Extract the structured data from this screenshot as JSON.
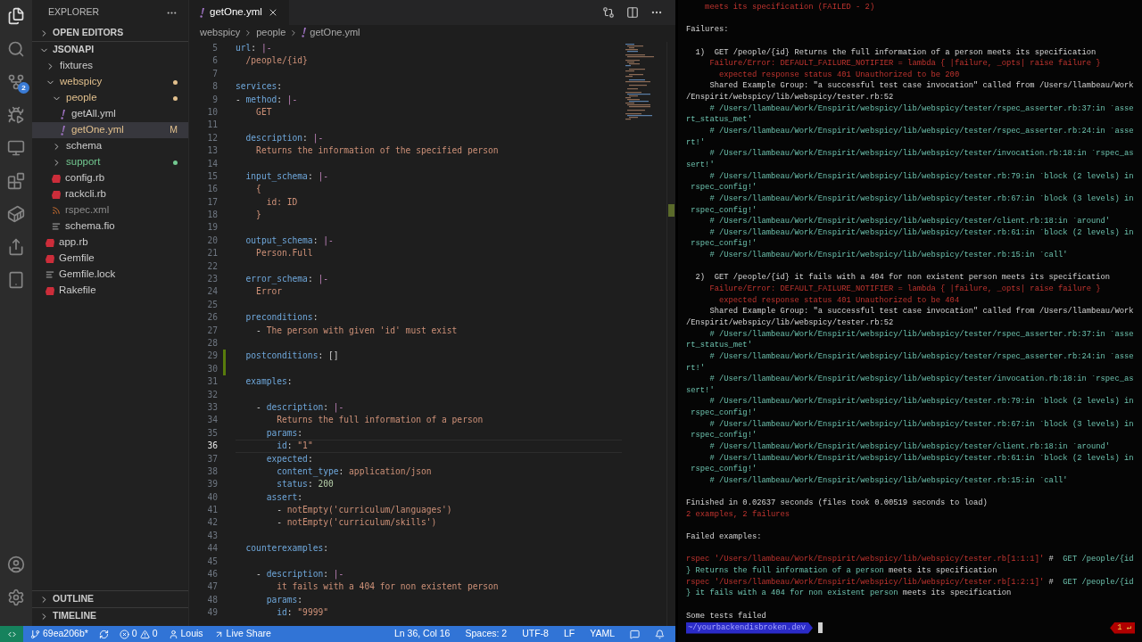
{
  "activity_bar": {
    "scm_badge": "2"
  },
  "explorer": {
    "title": "EXPLORER",
    "open_editors": {
      "label": "OPEN EDITORS",
      "expanded": false
    },
    "tree": {
      "label": "JSONAPI",
      "expanded": true,
      "children": [
        {
          "label": "fixtures",
          "kind": "folder",
          "expanded": false,
          "color": "#cccccc",
          "dot": false,
          "selected": false
        },
        {
          "label": "webspicy",
          "kind": "folder",
          "expanded": true,
          "color": "#e2c08d",
          "dot": true,
          "selected": false,
          "children": [
            {
              "label": "people",
              "kind": "folder",
              "expanded": true,
              "color": "#e2c08d",
              "dot": true,
              "selected": false,
              "children": [
                {
                  "label": "getAll.yml",
                  "kind": "yaml",
                  "color": "#cccccc",
                  "selected": false
                },
                {
                  "label": "getOne.yml",
                  "kind": "yaml",
                  "color": "#e2c08d",
                  "badge": "M",
                  "selected": true
                }
              ]
            },
            {
              "label": "schema",
              "kind": "folder",
              "expanded": false,
              "color": "#cccccc",
              "dot": false,
              "selected": false
            },
            {
              "label": "support",
              "kind": "folder",
              "expanded": false,
              "color": "#73c991",
              "dot": true,
              "selected": false
            },
            {
              "label": "config.rb",
              "kind": "ruby",
              "color": "#cccccc",
              "selected": false
            },
            {
              "label": "rackcli.rb",
              "kind": "ruby",
              "color": "#cccccc",
              "selected": false
            },
            {
              "label": "rspec.xml",
              "kind": "feed",
              "color": "#8c8c8c",
              "selected": false
            },
            {
              "label": "schema.fio",
              "kind": "text",
              "color": "#cccccc",
              "selected": false
            }
          ]
        },
        {
          "label": "app.rb",
          "kind": "ruby",
          "color": "#cccccc",
          "selected": false
        },
        {
          "label": "Gemfile",
          "kind": "ruby",
          "color": "#cccccc",
          "selected": false
        },
        {
          "label": "Gemfile.lock",
          "kind": "text",
          "color": "#cccccc",
          "selected": false
        },
        {
          "label": "Rakefile",
          "kind": "ruby",
          "color": "#cccccc",
          "selected": false
        }
      ]
    },
    "outline": {
      "label": "OUTLINE",
      "expanded": false
    },
    "timeline": {
      "label": "TIMELINE",
      "expanded": false
    }
  },
  "editor": {
    "tab": {
      "label": "getOne.yml",
      "selected": true
    },
    "breadcrumbs": [
      "webspicy",
      "people",
      "getOne.yml"
    ],
    "lines": [
      {
        "n": "5",
        "added": false,
        "current": false,
        "segs": [
          {
            "kind": "key",
            "t": "url"
          },
          {
            "kind": "punct",
            "t": ": "
          },
          {
            "kind": "op",
            "t": "|-"
          }
        ]
      },
      {
        "n": "6",
        "added": false,
        "current": false,
        "segs": [
          {
            "kind": "str",
            "t": "  /people/{id}"
          }
        ]
      },
      {
        "n": "7",
        "added": false,
        "current": false
      },
      {
        "n": "8",
        "added": false,
        "current": false,
        "segs": [
          {
            "kind": "key",
            "t": "services"
          },
          {
            "kind": "punct",
            "t": ":"
          }
        ]
      },
      {
        "n": "9",
        "added": false,
        "current": false,
        "segs": [
          {
            "kind": "punct",
            "t": "- "
          },
          {
            "kind": "key",
            "t": "method"
          },
          {
            "kind": "punct",
            "t": ": "
          },
          {
            "kind": "op",
            "t": "|-"
          }
        ]
      },
      {
        "n": "10",
        "added": false,
        "current": false,
        "segs": [
          {
            "kind": "str",
            "t": "    GET"
          }
        ]
      },
      {
        "n": "11",
        "added": false,
        "current": false
      },
      {
        "n": "12",
        "added": false,
        "current": false,
        "segs": [
          {
            "kind": "key",
            "t": "  description"
          },
          {
            "kind": "punct",
            "t": ": "
          },
          {
            "kind": "op",
            "t": "|-"
          }
        ]
      },
      {
        "n": "13",
        "added": false,
        "current": false,
        "segs": [
          {
            "kind": "str",
            "t": "    Returns the information of the specified person"
          }
        ]
      },
      {
        "n": "14",
        "added": false,
        "current": false
      },
      {
        "n": "15",
        "added": false,
        "current": false,
        "segs": [
          {
            "kind": "key",
            "t": "  input_schema"
          },
          {
            "kind": "punct",
            "t": ": "
          },
          {
            "kind": "op",
            "t": "|-"
          }
        ]
      },
      {
        "n": "16",
        "added": false,
        "current": false,
        "segs": [
          {
            "kind": "str",
            "t": "    {"
          }
        ]
      },
      {
        "n": "17",
        "added": false,
        "current": false,
        "segs": [
          {
            "kind": "str",
            "t": "      id: ID"
          }
        ]
      },
      {
        "n": "18",
        "added": false,
        "current": false,
        "segs": [
          {
            "kind": "str",
            "t": "    }"
          }
        ]
      },
      {
        "n": "19",
        "added": false,
        "current": false
      },
      {
        "n": "20",
        "added": false,
        "current": false,
        "segs": [
          {
            "kind": "key",
            "t": "  output_schema"
          },
          {
            "kind": "punct",
            "t": ": "
          },
          {
            "kind": "op",
            "t": "|-"
          }
        ]
      },
      {
        "n": "21",
        "added": false,
        "current": false,
        "segs": [
          {
            "kind": "str",
            "t": "    Person.Full"
          }
        ]
      },
      {
        "n": "22",
        "added": false,
        "current": false
      },
      {
        "n": "23",
        "added": false,
        "current": false,
        "segs": [
          {
            "kind": "key",
            "t": "  error_schema"
          },
          {
            "kind": "punct",
            "t": ": "
          },
          {
            "kind": "op",
            "t": "|-"
          }
        ]
      },
      {
        "n": "24",
        "added": false,
        "current": false,
        "segs": [
          {
            "kind": "str",
            "t": "    Error"
          }
        ]
      },
      {
        "n": "25",
        "added": false,
        "current": false
      },
      {
        "n": "26",
        "added": false,
        "current": false,
        "segs": [
          {
            "kind": "key",
            "t": "  preconditions"
          },
          {
            "kind": "punct",
            "t": ":"
          }
        ]
      },
      {
        "n": "27",
        "added": false,
        "current": false,
        "segs": [
          {
            "kind": "punct",
            "t": "    - "
          },
          {
            "kind": "str",
            "t": "The person with given 'id' must exist"
          }
        ]
      },
      {
        "n": "28",
        "added": false,
        "current": false
      },
      {
        "n": "29",
        "added": true,
        "current": false,
        "segs": [
          {
            "kind": "key",
            "t": "  postconditions"
          },
          {
            "kind": "punct",
            "t": ": []"
          }
        ]
      },
      {
        "n": "30",
        "added": true,
        "current": false
      },
      {
        "n": "31",
        "added": false,
        "current": false,
        "segs": [
          {
            "kind": "key",
            "t": "  examples"
          },
          {
            "kind": "punct",
            "t": ":"
          }
        ]
      },
      {
        "n": "32",
        "added": false,
        "current": false
      },
      {
        "n": "33",
        "added": false,
        "current": false,
        "segs": [
          {
            "kind": "punct",
            "t": "    - "
          },
          {
            "kind": "key",
            "t": "description"
          },
          {
            "kind": "punct",
            "t": ": "
          },
          {
            "kind": "op",
            "t": "|-"
          }
        ]
      },
      {
        "n": "34",
        "added": false,
        "current": false,
        "segs": [
          {
            "kind": "str",
            "t": "        Returns the full information of a person"
          }
        ]
      },
      {
        "n": "35",
        "added": false,
        "current": false,
        "segs": [
          {
            "kind": "key",
            "t": "      params"
          },
          {
            "kind": "punct",
            "t": ":"
          }
        ]
      },
      {
        "n": "36",
        "added": false,
        "current": true,
        "segs": [
          {
            "kind": "key",
            "t": "        id"
          },
          {
            "kind": "punct",
            "t": ": "
          },
          {
            "kind": "str",
            "t": "\"1\""
          }
        ]
      },
      {
        "n": "37",
        "added": false,
        "current": false,
        "segs": [
          {
            "kind": "key",
            "t": "      expected"
          },
          {
            "kind": "punct",
            "t": ":"
          }
        ]
      },
      {
        "n": "38",
        "added": false,
        "current": false,
        "segs": [
          {
            "kind": "key",
            "t": "        content_type"
          },
          {
            "kind": "punct",
            "t": ": "
          },
          {
            "kind": "str",
            "t": "application/json"
          }
        ]
      },
      {
        "n": "39",
        "added": false,
        "current": false,
        "segs": [
          {
            "kind": "key",
            "t": "        status"
          },
          {
            "kind": "punct",
            "t": ": "
          },
          {
            "kind": "num",
            "t": "200"
          }
        ]
      },
      {
        "n": "40",
        "added": false,
        "current": false,
        "segs": [
          {
            "kind": "key",
            "t": "      assert"
          },
          {
            "kind": "punct",
            "t": ":"
          }
        ]
      },
      {
        "n": "41",
        "added": false,
        "current": false,
        "segs": [
          {
            "kind": "punct",
            "t": "        - "
          },
          {
            "kind": "str",
            "t": "notEmpty('curriculum/languages')"
          }
        ]
      },
      {
        "n": "42",
        "added": false,
        "current": false,
        "segs": [
          {
            "kind": "punct",
            "t": "        - "
          },
          {
            "kind": "str",
            "t": "notEmpty('curriculum/skills')"
          }
        ]
      },
      {
        "n": "43",
        "added": false,
        "current": false
      },
      {
        "n": "44",
        "added": false,
        "current": false,
        "segs": [
          {
            "kind": "key",
            "t": "  counterexamples"
          },
          {
            "kind": "punct",
            "t": ":"
          }
        ]
      },
      {
        "n": "45",
        "added": false,
        "current": false
      },
      {
        "n": "46",
        "added": false,
        "current": false,
        "segs": [
          {
            "kind": "punct",
            "t": "    - "
          },
          {
            "kind": "key",
            "t": "description"
          },
          {
            "kind": "punct",
            "t": ": "
          },
          {
            "kind": "op",
            "t": "|-"
          }
        ]
      },
      {
        "n": "47",
        "added": false,
        "current": false,
        "segs": [
          {
            "kind": "str",
            "t": "        it fails with a 404 for non existent person"
          }
        ]
      },
      {
        "n": "48",
        "added": false,
        "current": false,
        "segs": [
          {
            "kind": "key",
            "t": "      params"
          },
          {
            "kind": "punct",
            "t": ":"
          }
        ]
      },
      {
        "n": "49",
        "added": false,
        "current": false,
        "segs": [
          {
            "kind": "key",
            "t": "        id"
          },
          {
            "kind": "punct",
            "t": ": "
          },
          {
            "kind": "str",
            "t": "\"9999\""
          }
        ]
      }
    ]
  },
  "status_bar": {
    "branch": "69ea206b*",
    "errors": "0",
    "warnings": "0",
    "user": "Louis",
    "live_share": "Live Share",
    "right": [
      "Ln 36, Col 16",
      "Spaces: 2",
      "UTF-8",
      "LF",
      "YAML"
    ]
  },
  "terminal": {
    "lines": [
      {
        "segs": [
          {
            "kind": "error",
            "t": "    meets its specification (FAILED - 2)"
          }
        ]
      },
      {
        "kind": "blank"
      },
      {
        "segs": [
          {
            "kind": "plain",
            "t": "Failures:"
          }
        ]
      },
      {
        "kind": "blank"
      },
      {
        "segs": [
          {
            "kind": "plain",
            "t": "  1)  GET /people/{id} Returns the full information of a person meets its specification"
          }
        ]
      },
      {
        "segs": [
          {
            "kind": "error",
            "t": "     Failure/Error: DEFAULT_FAILURE_NOTIFIER = lambda { |failure, _opts| raise failure }"
          }
        ]
      },
      {
        "segs": [
          {
            "kind": "error",
            "t": "       expected response status 401 Unauthorized to be 200"
          }
        ]
      },
      {
        "segs": [
          {
            "kind": "plain",
            "t": "     Shared Example Group: \"a successful test case invocation\" called from /Users/llambeau/Work"
          }
        ]
      },
      {
        "segs": [
          {
            "kind": "plain",
            "t": "/Enspirit/webspicy/lib/webspicy/tester.rb:52"
          }
        ]
      },
      {
        "segs": [
          {
            "kind": "trace",
            "t": "     # /Users/llambeau/Work/Enspirit/webspicy/lib/webspicy/tester/rspec_asserter.rb:37:in `asse"
          }
        ]
      },
      {
        "segs": [
          {
            "kind": "trace",
            "t": "rt_status_met'"
          }
        ]
      },
      {
        "segs": [
          {
            "kind": "trace",
            "t": "     # /Users/llambeau/Work/Enspirit/webspicy/lib/webspicy/tester/rspec_asserter.rb:24:in `asse"
          }
        ]
      },
      {
        "segs": [
          {
            "kind": "trace",
            "t": "rt!'"
          }
        ]
      },
      {
        "segs": [
          {
            "kind": "trace",
            "t": "     # /Users/llambeau/Work/Enspirit/webspicy/lib/webspicy/tester/invocation.rb:18:in `rspec_as"
          }
        ]
      },
      {
        "segs": [
          {
            "kind": "trace",
            "t": "sert!'"
          }
        ]
      },
      {
        "segs": [
          {
            "kind": "trace",
            "t": "     # /Users/llambeau/Work/Enspirit/webspicy/lib/webspicy/tester.rb:79:in `block (2 levels) in"
          }
        ]
      },
      {
        "segs": [
          {
            "kind": "trace",
            "t": " rspec_config!'"
          }
        ]
      },
      {
        "segs": [
          {
            "kind": "trace",
            "t": "     # /Users/llambeau/Work/Enspirit/webspicy/lib/webspicy/tester.rb:67:in `block (3 levels) in"
          }
        ]
      },
      {
        "segs": [
          {
            "kind": "trace",
            "t": " rspec_config!'"
          }
        ]
      },
      {
        "segs": [
          {
            "kind": "trace",
            "t": "     # /Users/llambeau/Work/Enspirit/webspicy/lib/webspicy/tester/client.rb:18:in `around'"
          }
        ]
      },
      {
        "segs": [
          {
            "kind": "trace",
            "t": "     # /Users/llambeau/Work/Enspirit/webspicy/lib/webspicy/tester.rb:61:in `block (2 levels) in"
          }
        ]
      },
      {
        "segs": [
          {
            "kind": "trace",
            "t": " rspec_config!'"
          }
        ]
      },
      {
        "segs": [
          {
            "kind": "trace",
            "t": "     # /Users/llambeau/Work/Enspirit/webspicy/lib/webspicy/tester.rb:15:in `call'"
          }
        ]
      },
      {
        "kind": "blank"
      },
      {
        "segs": [
          {
            "kind": "plain",
            "t": "  2)  GET /people/{id} it fails with a 404 for non existent person meets its specification"
          }
        ]
      },
      {
        "segs": [
          {
            "kind": "error",
            "t": "     Failure/Error: DEFAULT_FAILURE_NOTIFIER = lambda { |failure, _opts| raise failure }"
          }
        ]
      },
      {
        "segs": [
          {
            "kind": "error",
            "t": "       expected response status 401 Unauthorized to be 404"
          }
        ]
      },
      {
        "segs": [
          {
            "kind": "plain",
            "t": "     Shared Example Group: \"a successful test case invocation\" called from /Users/llambeau/Work"
          }
        ]
      },
      {
        "segs": [
          {
            "kind": "plain",
            "t": "/Enspirit/webspicy/lib/webspicy/tester.rb:52"
          }
        ]
      },
      {
        "segs": [
          {
            "kind": "trace",
            "t": "     # /Users/llambeau/Work/Enspirit/webspicy/lib/webspicy/tester/rspec_asserter.rb:37:in `asse"
          }
        ]
      },
      {
        "segs": [
          {
            "kind": "trace",
            "t": "rt_status_met'"
          }
        ]
      },
      {
        "segs": [
          {
            "kind": "trace",
            "t": "     # /Users/llambeau/Work/Enspirit/webspicy/lib/webspicy/tester/rspec_asserter.rb:24:in `asse"
          }
        ]
      },
      {
        "segs": [
          {
            "kind": "trace",
            "t": "rt!'"
          }
        ]
      },
      {
        "segs": [
          {
            "kind": "trace",
            "t": "     # /Users/llambeau/Work/Enspirit/webspicy/lib/webspicy/tester/invocation.rb:18:in `rspec_as"
          }
        ]
      },
      {
        "segs": [
          {
            "kind": "trace",
            "t": "sert!'"
          }
        ]
      },
      {
        "segs": [
          {
            "kind": "trace",
            "t": "     # /Users/llambeau/Work/Enspirit/webspicy/lib/webspicy/tester.rb:79:in `block (2 levels) in"
          }
        ]
      },
      {
        "segs": [
          {
            "kind": "trace",
            "t": " rspec_config!'"
          }
        ]
      },
      {
        "segs": [
          {
            "kind": "trace",
            "t": "     # /Users/llambeau/Work/Enspirit/webspicy/lib/webspicy/tester.rb:67:in `block (3 levels) in"
          }
        ]
      },
      {
        "segs": [
          {
            "kind": "trace",
            "t": " rspec_config!'"
          }
        ]
      },
      {
        "segs": [
          {
            "kind": "trace",
            "t": "     # /Users/llambeau/Work/Enspirit/webspicy/lib/webspicy/tester/client.rb:18:in `around'"
          }
        ]
      },
      {
        "segs": [
          {
            "kind": "trace",
            "t": "     # /Users/llambeau/Work/Enspirit/webspicy/lib/webspicy/tester.rb:61:in `block (2 levels) in"
          }
        ]
      },
      {
        "segs": [
          {
            "kind": "trace",
            "t": " rspec_config!'"
          }
        ]
      },
      {
        "segs": [
          {
            "kind": "trace",
            "t": "     # /Users/llambeau/Work/Enspirit/webspicy/lib/webspicy/tester.rb:15:in `call'"
          }
        ]
      },
      {
        "kind": "blank"
      },
      {
        "segs": [
          {
            "kind": "plain",
            "t": "Finished in 0.02637 seconds (files took 0.00519 seconds to load)"
          }
        ]
      },
      {
        "segs": [
          {
            "kind": "error",
            "t": "2 examples, 2 failures"
          }
        ]
      },
      {
        "kind": "blank"
      },
      {
        "segs": [
          {
            "kind": "plain",
            "t": "Failed examples:"
          }
        ]
      },
      {
        "kind": "blank"
      },
      {
        "segs": [
          {
            "kind": "error",
            "t": "rspec '/Users/llambeau/Work/Enspirit/webspicy/lib/webspicy/tester.rb[1:1:1]'"
          },
          {
            "kind": "plain",
            "t": " # "
          },
          {
            "kind": "trace",
            "t": " GET /people/{id"
          }
        ]
      },
      {
        "segs": [
          {
            "kind": "trace",
            "t": "} Returns the full information of a person"
          },
          {
            "kind": "plain",
            "t": " meets its specification"
          }
        ]
      },
      {
        "segs": [
          {
            "kind": "error",
            "t": "rspec '/Users/llambeau/Work/Enspirit/webspicy/lib/webspicy/tester.rb[1:2:1]'"
          },
          {
            "kind": "plain",
            "t": " # "
          },
          {
            "kind": "trace",
            "t": " GET /people/{id"
          }
        ]
      },
      {
        "segs": [
          {
            "kind": "trace",
            "t": "} it fails with a 404 for non existent person"
          },
          {
            "kind": "plain",
            "t": " meets its specification"
          }
        ]
      },
      {
        "kind": "blank"
      },
      {
        "segs": [
          {
            "kind": "plain",
            "t": "Some tests failed"
          }
        ]
      }
    ],
    "prompt": {
      "path": "~/yourbackendisbroken.dev",
      "exit": "1 ↵"
    }
  }
}
